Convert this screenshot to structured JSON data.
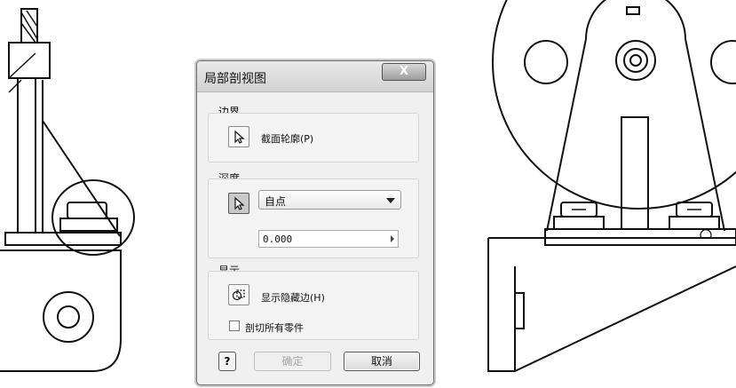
{
  "dialog": {
    "title": "局部剖视图",
    "close_label": "X",
    "boundary": {
      "section_label": "边界",
      "profile_button_label": "截面轮廓(P)"
    },
    "depth": {
      "section_label": "深度",
      "mode_selected": "自点",
      "value": "0.000"
    },
    "display": {
      "section_label": "显示",
      "show_hidden_label": "显示隐藏边(H)",
      "cut_all_parts_label": "剖切所有零件",
      "cut_all_parts_checked": false
    },
    "footer": {
      "help_label": "?",
      "ok_label": "确定",
      "cancel_label": "取消"
    }
  },
  "icons": {
    "profile": "cursor-arrow-icon",
    "depth_point": "cursor-arrow-icon",
    "show_hidden": "hidden-edges-icon",
    "close": "close-icon",
    "help": "help-icon"
  }
}
